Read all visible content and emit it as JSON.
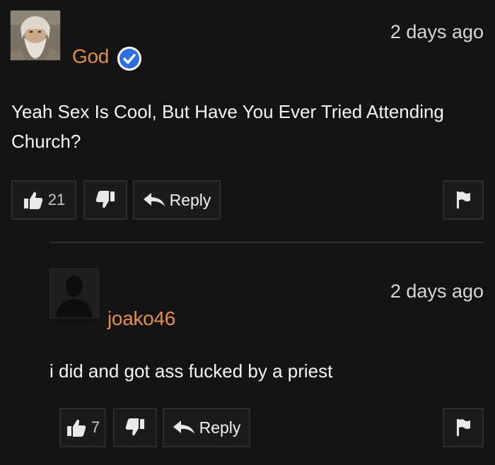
{
  "comments": [
    {
      "username": "God",
      "timestamp": "2 days ago",
      "text": "Yeah Sex Is Cool, But Have You Ever Tried Attending Church?",
      "likes": "21",
      "reply_label": "Reply",
      "verified": true,
      "avatar": "bearded-man-painting"
    },
    {
      "username": "joako46",
      "timestamp": "2 days ago",
      "text": "i did and got ass fucked by a priest",
      "likes": "7",
      "reply_label": "Reply",
      "verified": false,
      "avatar": "default-silhouette"
    }
  ],
  "colors": {
    "background": "#131313",
    "username": "#e58f4a",
    "verified_badge": "#2d6fe0",
    "button_bg": "#1b1b1b"
  },
  "icons": [
    "thumbs-up-icon",
    "thumbs-down-icon",
    "reply-arrow-icon",
    "flag-icon",
    "verified-check-icon"
  ]
}
